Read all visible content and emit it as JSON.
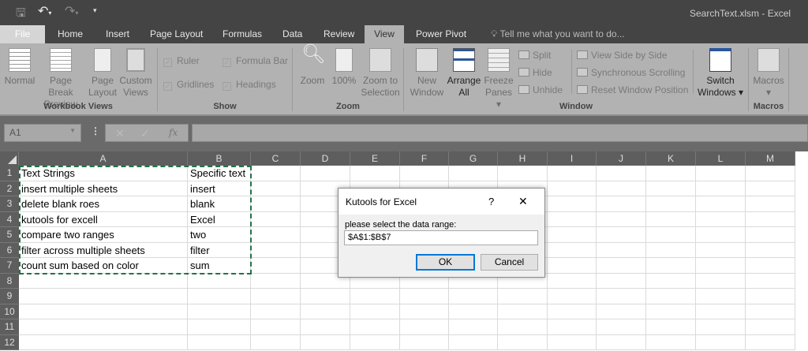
{
  "window": {
    "title": "SearchText.xlsm - Excel"
  },
  "qat": {
    "save": "save-icon",
    "undo": "undo-icon",
    "redo": "redo-icon",
    "customize": "customize-icon"
  },
  "tabs": [
    "File",
    "Home",
    "Insert",
    "Page Layout",
    "Formulas",
    "Data",
    "Review",
    "View",
    "Power Pivot"
  ],
  "tell_me": "Tell me what you want to do...",
  "ribbon": {
    "workbook_views": {
      "label": "Workbook Views",
      "buttons": [
        [
          "Normal",
          ""
        ],
        [
          "Page Break",
          "Preview"
        ],
        [
          "Page",
          "Layout"
        ],
        [
          "Custom",
          "Views"
        ]
      ]
    },
    "show": {
      "label": "Show",
      "checks": [
        "Ruler",
        "Formula Bar",
        "Gridlines",
        "Headings"
      ]
    },
    "zoom": {
      "label": "Zoom",
      "buttons": [
        [
          "Zoom",
          ""
        ],
        [
          "100%",
          ""
        ],
        [
          "Zoom to",
          "Selection"
        ]
      ]
    },
    "window": {
      "label": "Window",
      "buttons": [
        [
          "New",
          "Window"
        ],
        [
          "Arrange",
          "All"
        ],
        [
          "Freeze",
          "Panes ▾"
        ]
      ],
      "small": [
        "Split",
        "Hide",
        "Unhide",
        "View Side by Side",
        "Synchronous Scrolling",
        "Reset Window Position"
      ],
      "switch": [
        "Switch",
        "Windows ▾"
      ]
    },
    "macros": {
      "label": "Macros",
      "button": [
        "Macros",
        "▾"
      ]
    }
  },
  "formula_bar": {
    "name_box": "A1",
    "cancel": "✕",
    "enter": "✓",
    "fx": "fx",
    "value": ""
  },
  "sheet": {
    "columns": [
      "A",
      "B",
      "C",
      "D",
      "E",
      "F",
      "G",
      "H",
      "I",
      "J",
      "K",
      "L",
      "M"
    ],
    "rows": [
      "1",
      "2",
      "3",
      "4",
      "5",
      "6",
      "7",
      "8",
      "9",
      "10",
      "11",
      "12"
    ],
    "data": [
      [
        "Text Strings",
        "Specific text"
      ],
      [
        "insert multiple sheets",
        "insert"
      ],
      [
        "delete blank roes",
        "blank"
      ],
      [
        "kutools for excell",
        "Excel"
      ],
      [
        "compare two ranges",
        "two"
      ],
      [
        "filter across multiple sheets",
        "filter"
      ],
      [
        "count sum based on color",
        "sum"
      ]
    ]
  },
  "dialog": {
    "title": "Kutools for Excel",
    "help": "?",
    "close": "✕",
    "prompt": "please select the data range:",
    "value": "$A$1:$B$7",
    "ok": "OK",
    "cancel": "Cancel"
  }
}
